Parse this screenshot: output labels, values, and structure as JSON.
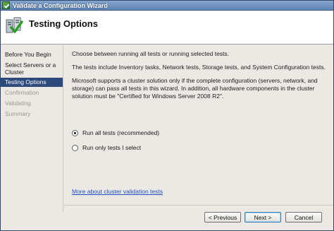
{
  "window": {
    "title": "Validate a Configuration Wizard"
  },
  "header": {
    "title": "Testing Options",
    "icon": "cluster-validation-icon"
  },
  "nav": {
    "items": [
      {
        "label": "Before You Begin",
        "state": "normal"
      },
      {
        "label": "Select Servers or a Cluster",
        "state": "normal"
      },
      {
        "label": "Testing Options",
        "state": "selected"
      },
      {
        "label": "Confirmation",
        "state": "disabled"
      },
      {
        "label": "Validating",
        "state": "disabled"
      },
      {
        "label": "Summary",
        "state": "disabled"
      }
    ]
  },
  "content": {
    "intro": "Choose between running all tests or running selected tests.",
    "tests_info": "The tests include Inventory tasks, Network tests, Storage tests, and System Configuration tests.",
    "support_info": "Microsoft supports a cluster solution only if the complete configuration (servers, network, and storage) can pass all tests in this wizard. In addition, all hardware components in the cluster solution must be \"Certified for Windows Server 2008 R2\".",
    "options": [
      {
        "label": "Run all tests (recommended)",
        "checked": true
      },
      {
        "label": "Run only tests I select",
        "checked": false
      }
    ],
    "more_link": "More about cluster validation tests"
  },
  "footer": {
    "previous_label": "< Previous",
    "next_label": "Next >",
    "cancel_label": "Cancel"
  },
  "colors": {
    "titlebar": "#5f84b4",
    "nav_selected": "#2c4a7c",
    "link": "#1f4fc2"
  }
}
